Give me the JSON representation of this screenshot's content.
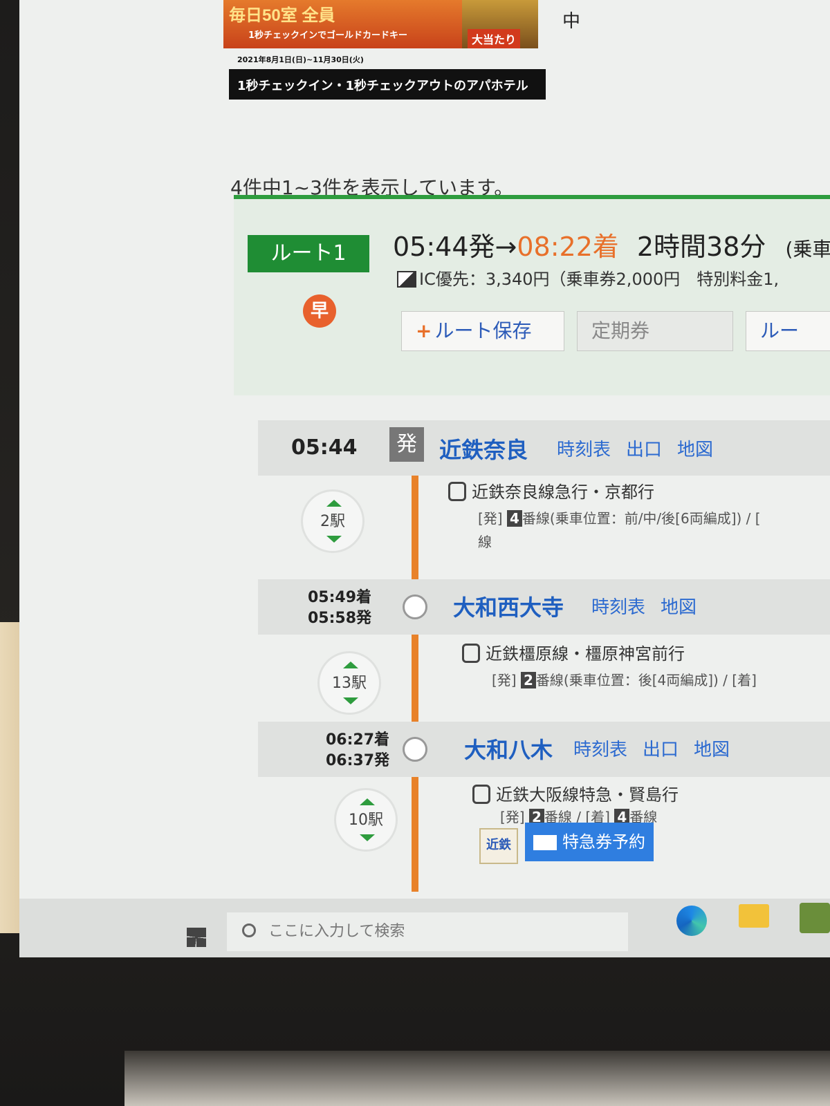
{
  "ad": {
    "title": "毎日50室 全員",
    "subtitle": "1秒チェックインでゴールドカードキー",
    "badge": "大当たり",
    "period": "2021年8月1日(日)~11月30日(火)",
    "strip": "1秒チェックイン・1秒チェックアウトのアパホテル",
    "side_text": "中"
  },
  "results": {
    "count_text": "4件中1~3件を表示しています。"
  },
  "route": {
    "label": "ルート1",
    "fast_badge": "早",
    "depart": "05:44発",
    "arrow": "→",
    "arrive": "08:22着",
    "duration": "2時間38分",
    "extra": "(乗車",
    "fare": "IC優先：3,340円（乗車券2,000円　特別料金1,",
    "buttons": {
      "save": "ルート保存",
      "save_plus": "+",
      "commuter_pass": "定期券",
      "route": "ルー"
    }
  },
  "itinerary": {
    "stations": [
      {
        "time": "05:44",
        "mark": "発",
        "name": "近鉄奈良",
        "links": [
          "時刻表",
          "出口",
          "地図"
        ]
      },
      {
        "arrive": "05:49着",
        "depart": "05:58発",
        "name": "大和西大寺",
        "links": [
          "時刻表",
          "地図"
        ]
      },
      {
        "arrive": "06:27着",
        "depart": "06:37発",
        "name": "大和八木",
        "links": [
          "時刻表",
          "出口",
          "地図"
        ]
      }
    ],
    "segments": [
      {
        "line": "近鉄奈良線急行・京都行",
        "detail_pre": "[発]",
        "platform": "4",
        "detail": "番線(乗車位置：前/中/後[6両編成]) / [",
        "wrap": "線",
        "stops": "2駅"
      },
      {
        "line": "近鉄橿原線・橿原神宮前行",
        "detail_pre": "[発]",
        "platform": "2",
        "detail": "番線(乗車位置：後[4両編成]) / [着]",
        "stops": "13駅"
      },
      {
        "line": "近鉄大阪線特急・賢島行",
        "detail_pre": "[発]",
        "platform": "2",
        "detail": "番線 / [着]",
        "platform2": "4",
        "detail2": "番線",
        "stops": "10駅"
      }
    ],
    "kintetsu_logo": "近鉄",
    "express_button": "特急券予約"
  },
  "taskbar": {
    "search_placeholder": "ここに入力して検索"
  },
  "colors": {
    "accent_green": "#2e9c3e",
    "arrival_orange": "#e8702a",
    "link_blue": "#2c6ad0"
  }
}
